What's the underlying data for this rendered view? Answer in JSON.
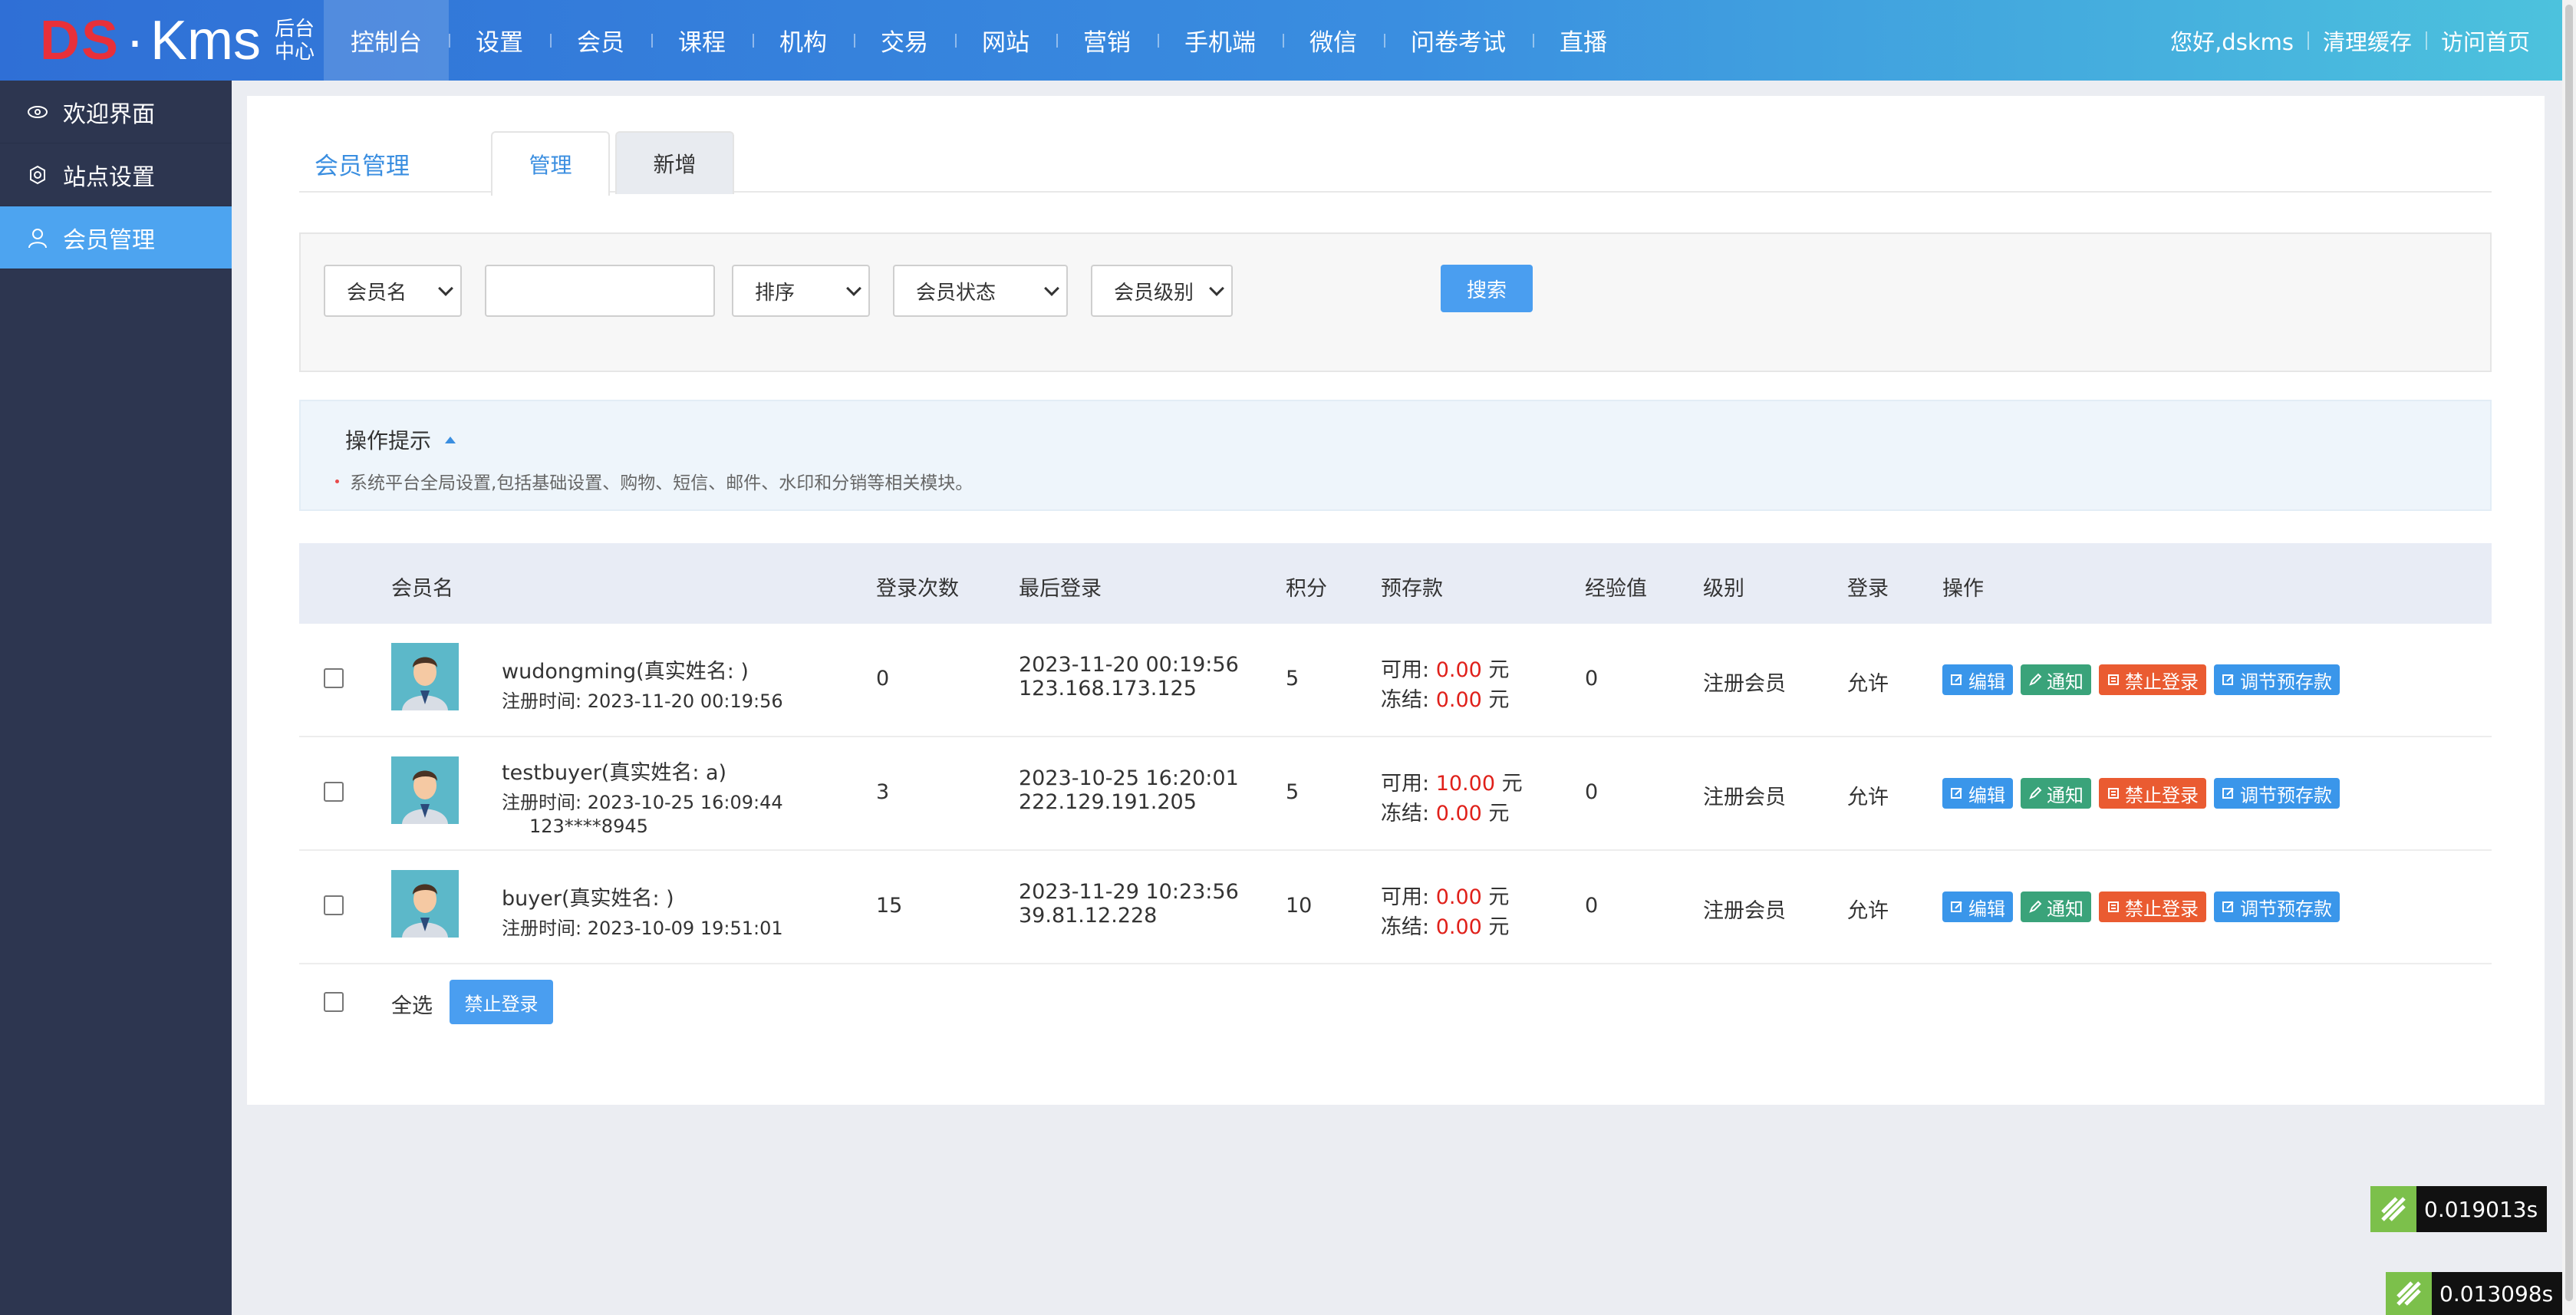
{
  "logo": {
    "ds": "DS",
    "dot": "·",
    "kms": "Kms",
    "sub_line1": "后台",
    "sub_line2": "中心"
  },
  "nav": [
    {
      "label": "控制台",
      "active": true
    },
    {
      "label": "设置"
    },
    {
      "label": "会员"
    },
    {
      "label": "课程"
    },
    {
      "label": "机构"
    },
    {
      "label": "交易"
    },
    {
      "label": "网站"
    },
    {
      "label": "营销"
    },
    {
      "label": "手机端"
    },
    {
      "label": "微信"
    },
    {
      "label": "问卷考试"
    },
    {
      "label": "直播"
    }
  ],
  "top_right": {
    "greeting": "您好,dskms",
    "clear_cache": "清理缓存",
    "visit_home": "访问首页"
  },
  "sidebar": [
    {
      "label": "欢迎界面",
      "icon": "eye-icon"
    },
    {
      "label": "站点设置",
      "icon": "gear-icon"
    },
    {
      "label": "会员管理",
      "icon": "user-icon",
      "active": true
    }
  ],
  "tabs": {
    "title": "会员管理",
    "manage": "管理",
    "add": "新增"
  },
  "search": {
    "field_select": "会员名",
    "keyword_value": "",
    "sort_select": "排序",
    "status_select": "会员状态",
    "level_select": "会员级别",
    "search_button": "搜索"
  },
  "tips": {
    "title": "操作提示",
    "text": "系统平台全局设置,包括基础设置、购物、短信、邮件、水印和分销等相关模块。"
  },
  "table": {
    "headers": {
      "name": "会员名",
      "logins": "登录次数",
      "last_login": "最后登录",
      "points": "积分",
      "deposit": "预存款",
      "exp": "经验值",
      "level": "级别",
      "login": "登录",
      "ops": "操作"
    },
    "rows": [
      {
        "name": "wudongming(真实姓名: )",
        "reg_time": "注册时间: 2023-11-20 00:19:56",
        "phone": "",
        "logins": "0",
        "last_login_time": "2023-11-20 00:19:56",
        "last_login_ip": "123.168.173.125",
        "points": "5",
        "available_label": "可用:",
        "available": "0.00",
        "frozen_label": "冻结:",
        "frozen": "0.00",
        "unit": "元",
        "exp": "0",
        "level": "注册会员",
        "login": "允许"
      },
      {
        "name": "testbuyer(真实姓名: a)",
        "reg_time": "注册时间: 2023-10-25 16:09:44",
        "phone": "123****8945",
        "logins": "3",
        "last_login_time": "2023-10-25 16:20:01",
        "last_login_ip": "222.129.191.205",
        "points": "5",
        "available_label": "可用:",
        "available": "10.00",
        "frozen_label": "冻结:",
        "frozen": "0.00",
        "unit": "元",
        "exp": "0",
        "level": "注册会员",
        "login": "允许"
      },
      {
        "name": "buyer(真实姓名: )",
        "reg_time": "注册时间: 2023-10-09 19:51:01",
        "phone": "",
        "logins": "15",
        "last_login_time": "2023-11-29 10:23:56",
        "last_login_ip": "39.81.12.228",
        "points": "10",
        "available_label": "可用:",
        "available": "0.00",
        "frozen_label": "冻结:",
        "frozen": "0.00",
        "unit": "元",
        "exp": "0",
        "level": "注册会员",
        "login": "允许"
      }
    ],
    "ops": {
      "edit": "编辑",
      "notify": "通知",
      "ban": "禁止登录",
      "adjust": "调节预存款"
    }
  },
  "footer": {
    "select_all": "全选",
    "ban_button": "禁止登录"
  },
  "timings": [
    "0.019013s",
    "0.013098s"
  ],
  "colors": {
    "primary": "#4a9ef0",
    "sidebar": "#2d3650",
    "danger": "#e0201a",
    "green": "#3aa37a",
    "orange": "#ea5b31"
  }
}
